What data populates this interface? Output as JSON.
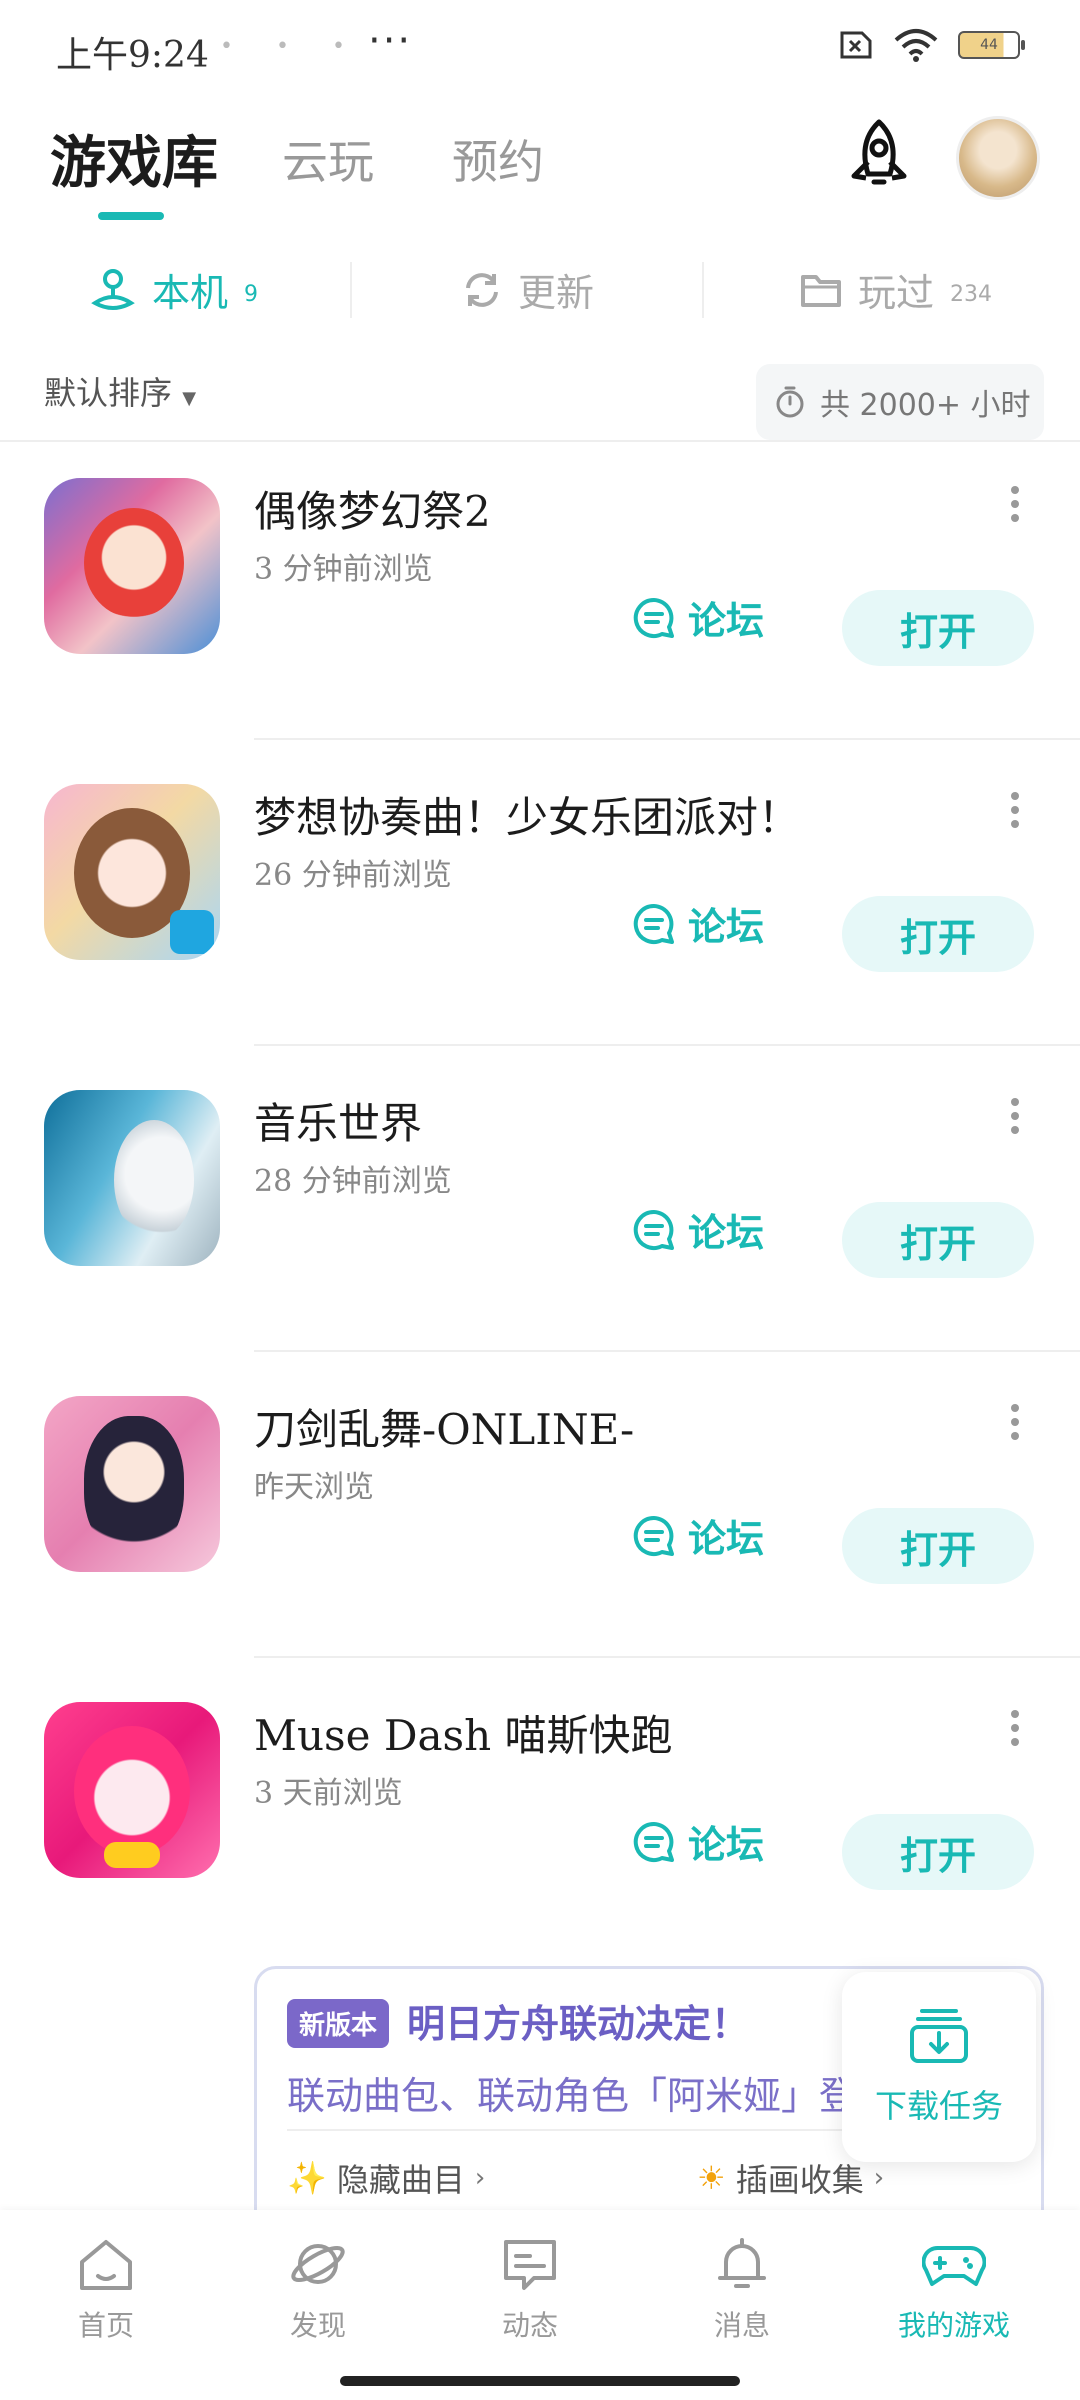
{
  "status": {
    "time": "上午9:24",
    "battery": "44"
  },
  "tabs": [
    {
      "label": "游戏库",
      "active": true
    },
    {
      "label": "云玩"
    },
    {
      "label": "预约"
    }
  ],
  "subtabs": {
    "local": {
      "label": "本机",
      "count": "9"
    },
    "update": {
      "label": "更新"
    },
    "played": {
      "label": "玩过",
      "count": "234"
    }
  },
  "sort_label": "默认排序",
  "total_hours": "共 2000+ 小时",
  "games": [
    {
      "title": "偶像梦幻祭2",
      "time": "3 分钟前浏览"
    },
    {
      "title": "梦想协奏曲！少女乐团派对！",
      "time": "26 分钟前浏览"
    },
    {
      "title": "音乐世界",
      "time": "28 分钟前浏览"
    },
    {
      "title": "刀剑乱舞-ONLINE-",
      "time": "昨天浏览"
    },
    {
      "title": "Muse Dash 喵斯快跑",
      "time": "3 天前浏览"
    }
  ],
  "actions": {
    "forum": "论坛",
    "open": "打开"
  },
  "news": {
    "badge": "新版本",
    "title": "明日方舟联动决定！",
    "subtitle": "联动曲包、联动角色「阿米娅」登",
    "item1": "隐藏曲目",
    "item2": "插画收集"
  },
  "download_tasks": "下载任务",
  "bottom_nav": [
    {
      "label": "首页"
    },
    {
      "label": "发现"
    },
    {
      "label": "动态"
    },
    {
      "label": "消息"
    },
    {
      "label": "我的游戏"
    }
  ],
  "colors": {
    "accent": "#19b9b4",
    "news_purple": "#6b5fc4"
  }
}
